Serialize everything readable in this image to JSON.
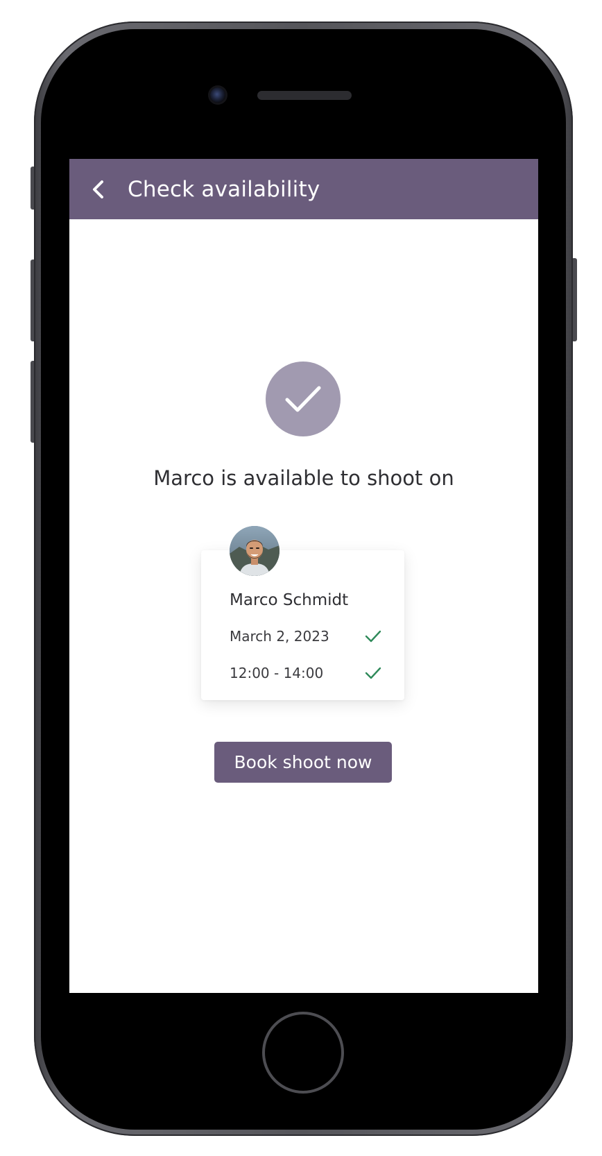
{
  "app_bar": {
    "title": "Check availability",
    "back_icon": "chevron-left-icon",
    "color": "#6a5c7c"
  },
  "status": {
    "icon": "checkmark-icon",
    "circle_color": "#a19ab0",
    "headline": "Marco is available to shoot on"
  },
  "photographer": {
    "name": "Marco Schmidt",
    "avatar": "avatar-photo",
    "date": "March 2, 2023",
    "time": "12:00 - 14:00",
    "confirm_icon": "check-icon",
    "confirm_color": "#2f8a5a"
  },
  "actions": {
    "book_label": "Book shoot now"
  }
}
